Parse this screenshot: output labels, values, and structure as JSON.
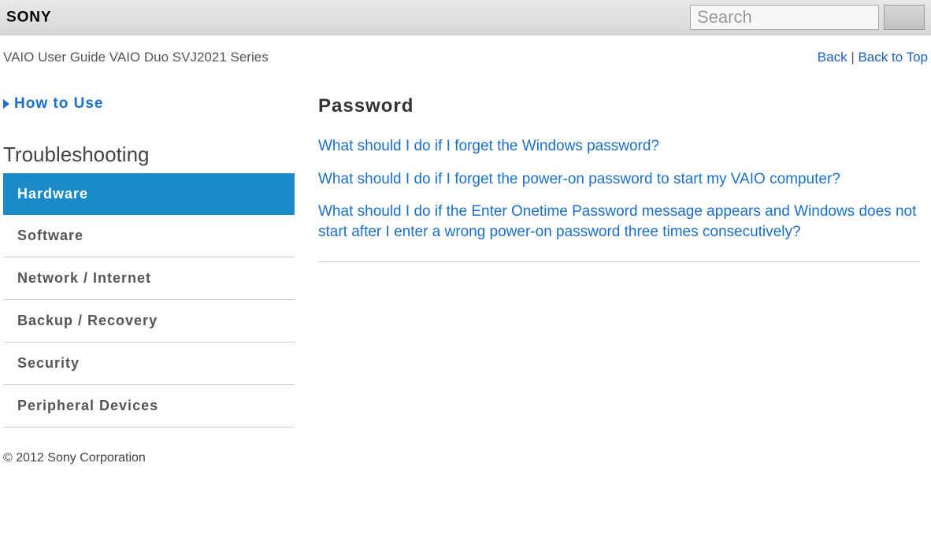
{
  "header": {
    "logo_text": "SONY",
    "search_placeholder": "Search"
  },
  "subheader": {
    "title": "VAIO User Guide VAIO Duo SVJ2021 Series",
    "back": "Back",
    "separator": " | ",
    "back_to_top": "Back to Top"
  },
  "sidebar": {
    "how_to_use": "How to Use",
    "section_title": "Troubleshooting",
    "items": [
      {
        "label": "Hardware",
        "active": true
      },
      {
        "label": "Software",
        "active": false
      },
      {
        "label": "Network / Internet",
        "active": false
      },
      {
        "label": "Backup / Recovery",
        "active": false
      },
      {
        "label": "Security",
        "active": false
      },
      {
        "label": "Peripheral Devices",
        "active": false
      }
    ]
  },
  "article": {
    "title": "Password",
    "links": [
      "What should I do if I forget the Windows password?",
      "What should I do if I forget the power-on password to start my VAIO computer?",
      "What should I do if the Enter Onetime Password message appears and Windows does not start after I enter a wrong power-on password three times consecutively?"
    ]
  },
  "footer": {
    "copyright": "© 2012 Sony Corporation"
  }
}
